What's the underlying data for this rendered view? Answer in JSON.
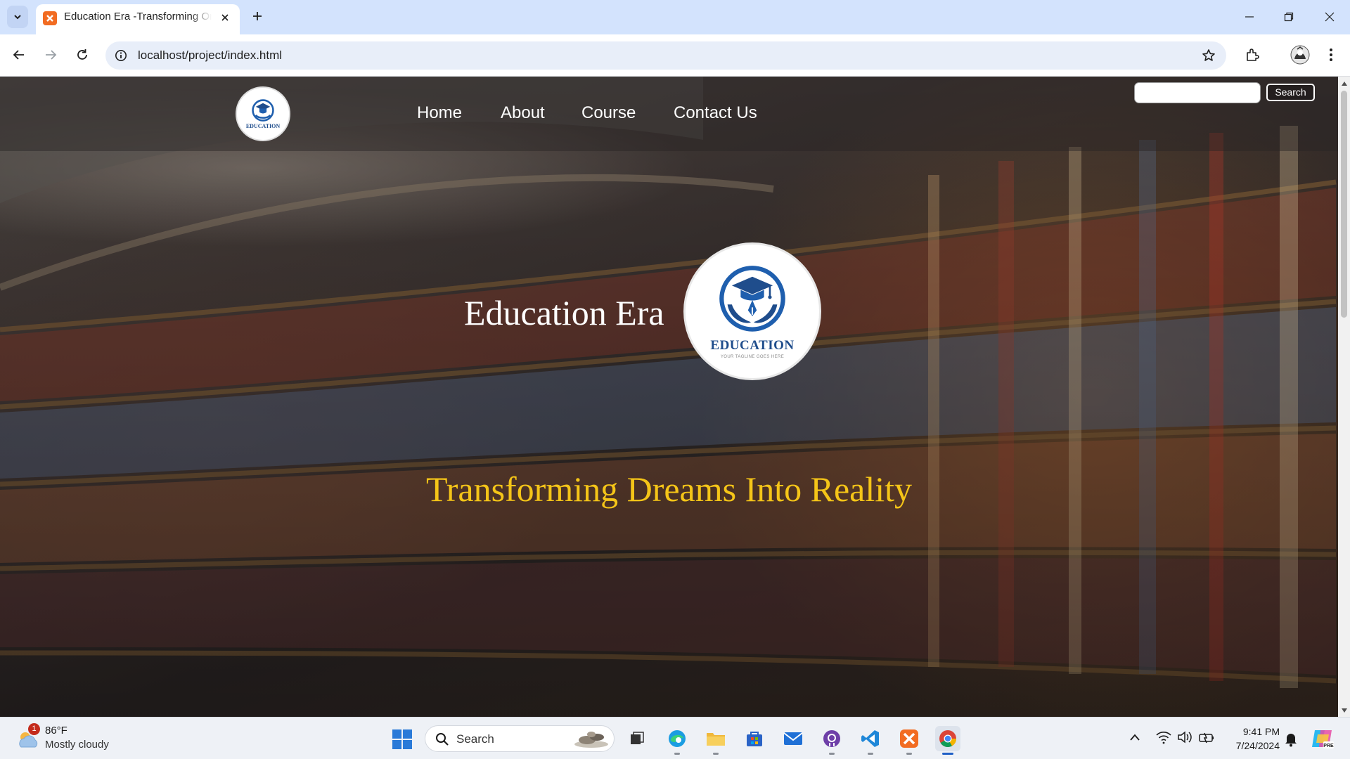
{
  "browser": {
    "tab_title": "Education Era -Transforming Or",
    "url": "localhost/project/index.html"
  },
  "site": {
    "nav": [
      "Home",
      "About",
      "Course",
      "Contact Us"
    ],
    "search_button": "Search",
    "search_value": "",
    "logo_small_text": "EDUCATION",
    "hero_title": "Education Era",
    "logo_big_text": "EDUCATION",
    "logo_big_tagline": "YOUR TAGLINE GOES HERE",
    "tagline": "Transforming Dreams Into Reality",
    "colors": {
      "tagline": "#f5c518",
      "logo_blue": "#1f4d8c"
    }
  },
  "taskbar": {
    "weather_badge": "1",
    "temperature": "86°F",
    "weather": "Mostly cloudy",
    "search_label": "Search",
    "time": "9:41 PM",
    "date": "7/24/2024",
    "apps": [
      "file-explorer-icon",
      "edge-icon",
      "folder-icon",
      "store-icon",
      "mail-icon",
      "github-icon",
      "vscode-icon",
      "xampp-icon",
      "chrome-icon"
    ]
  }
}
